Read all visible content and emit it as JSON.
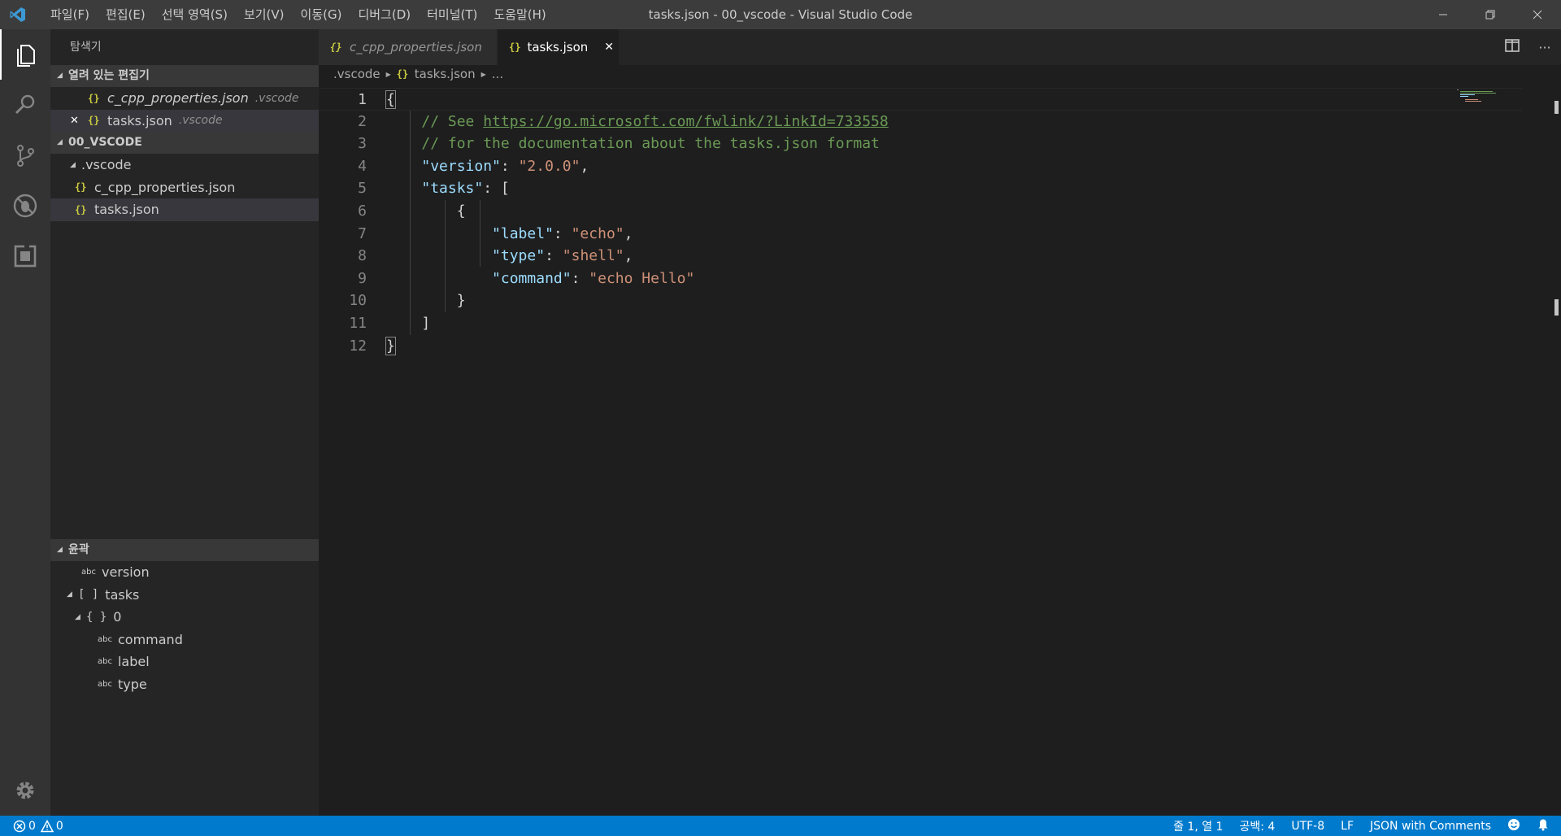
{
  "titlebar": {
    "menu": [
      "파일(F)",
      "편집(E)",
      "선택 영역(S)",
      "보기(V)",
      "이동(G)",
      "디버그(D)",
      "터미널(T)",
      "도움말(H)"
    ],
    "title": "tasks.json - 00_vscode - Visual Studio Code"
  },
  "sidebar": {
    "title": "탐색기",
    "open_editors": {
      "header": "열려 있는 편집기",
      "items": [
        {
          "name": "c_cpp_properties.json",
          "folder": ".vscode"
        },
        {
          "name": "tasks.json",
          "folder": ".vscode"
        }
      ]
    },
    "workspace": {
      "header": "00_VSCODE",
      "folder": ".vscode",
      "files": [
        "c_cpp_properties.json",
        "tasks.json"
      ]
    },
    "outline": {
      "header": "윤곽",
      "items": [
        {
          "icon": "abc",
          "label": "version"
        },
        {
          "icon": "[ ]",
          "label": "tasks"
        },
        {
          "icon": "{ }",
          "label": "0"
        },
        {
          "icon": "abc",
          "label": "command"
        },
        {
          "icon": "abc",
          "label": "label"
        },
        {
          "icon": "abc",
          "label": "type"
        }
      ]
    }
  },
  "editor": {
    "tabs": [
      {
        "label": "c_cpp_properties.json",
        "active": false
      },
      {
        "label": "tasks.json",
        "active": true
      }
    ],
    "breadcrumbs": [
      ".vscode",
      "tasks.json",
      "..."
    ],
    "line_numbers": [
      "1",
      "2",
      "3",
      "4",
      "5",
      "6",
      "7",
      "8",
      "9",
      "10",
      "11",
      "12"
    ],
    "code": {
      "l1": "{",
      "l2_comment": "// See ",
      "l2_link": "https://go.microsoft.com/fwlink/?LinkId=733558",
      "l3": "// for the documentation about the tasks.json format",
      "l4_key": "\"version\"",
      "l4_val": "\"2.0.0\"",
      "l5_key": "\"tasks\"",
      "l5_rest": ": [",
      "l6": "{",
      "l7_key": "\"label\"",
      "l7_val": "\"echo\"",
      "l8_key": "\"type\"",
      "l8_val": "\"shell\"",
      "l9_key": "\"command\"",
      "l9_val": "\"echo Hello\"",
      "l10": "}",
      "l11": "]",
      "l12": "}"
    }
  },
  "statusbar": {
    "errors": "0",
    "warnings": "0",
    "position": "줄 1, 열 1",
    "spaces": "공백: 4",
    "encoding": "UTF-8",
    "eol": "LF",
    "language": "JSON with Comments"
  },
  "colors": {
    "accent": "#007acc",
    "json_icon": "#cbcb41",
    "comment": "#6a9955",
    "key": "#9cdcfe",
    "string": "#ce9178"
  }
}
